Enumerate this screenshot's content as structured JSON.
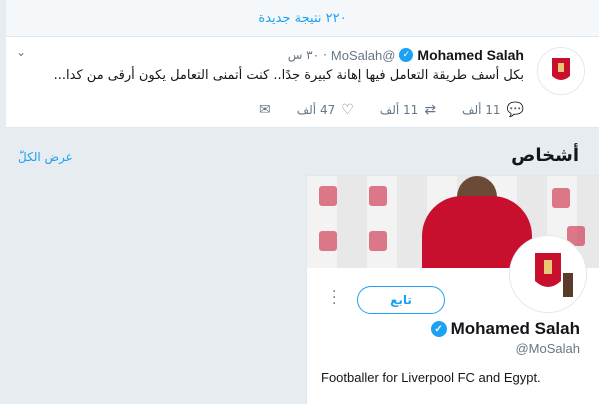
{
  "banner": {
    "new_results": "٢٢٠ نتيجة جديدة"
  },
  "tweet": {
    "name": "Mohamed Salah",
    "handle": "@MoSalah",
    "time": "٣٠ س",
    "text": "بكل أسف طريقة التعامل فيها إهانة كبيرة جدًا.. كنت أتمنى التعامل يكون أرقى من كدا...",
    "replies": "11 ألف",
    "retweets": "11 ألف",
    "likes": "47 ألف",
    "icons": [
      "chevron-down-icon",
      "reply-icon",
      "retweet-icon",
      "heart-icon",
      "mail-icon",
      "verified-badge-icon"
    ]
  },
  "people": {
    "title": "أشخاص",
    "view_all": "عرض الكلّ",
    "card": {
      "name": "Mohamed Salah",
      "handle": "@MoSalah",
      "follow_label": "تابع",
      "bio": "Footballer for Liverpool FC and Egypt."
    }
  },
  "colors": {
    "accent": "#1da1f2",
    "background": "#e6ecf0",
    "liverpool_red": "#c8102e"
  }
}
